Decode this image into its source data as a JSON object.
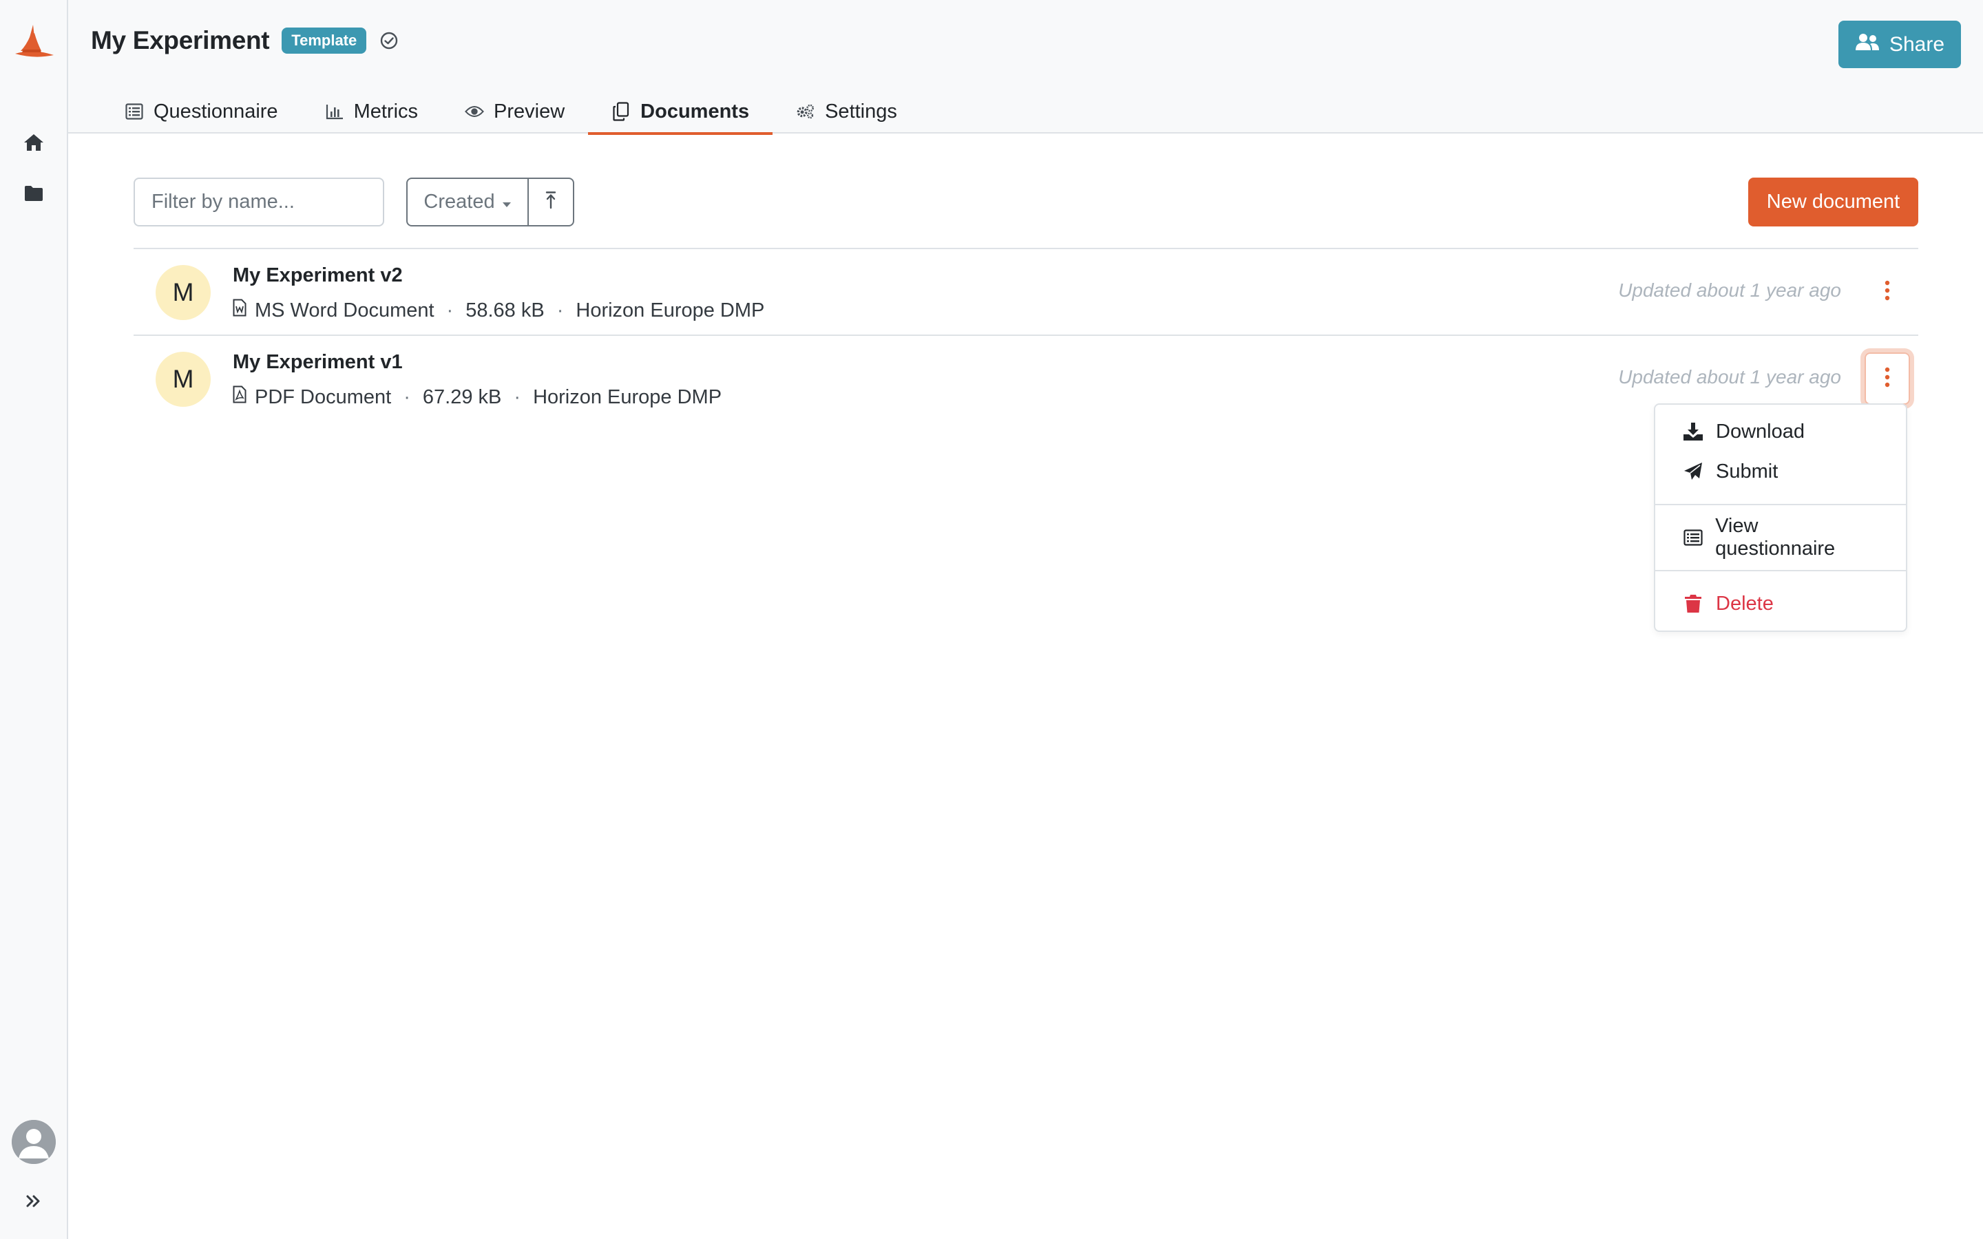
{
  "sidebar": {
    "logo": "wizard-hat-logo",
    "items": [
      {
        "icon": "home-icon",
        "label": ""
      },
      {
        "icon": "folder-icon",
        "label": ""
      }
    ],
    "profile_icon": "user-avatar-icon",
    "expand_icon": "double-chevron-right-icon"
  },
  "header": {
    "title": "My Experiment",
    "badge": "Template",
    "status_icon": "check-circle-icon",
    "share_label": "Share"
  },
  "tabs": [
    {
      "label": "Questionnaire",
      "icon": "list-icon",
      "active": false
    },
    {
      "label": "Metrics",
      "icon": "bar-chart-icon",
      "active": false
    },
    {
      "label": "Preview",
      "icon": "eye-icon",
      "active": false
    },
    {
      "label": "Documents",
      "icon": "copy-icon",
      "active": true
    },
    {
      "label": "Settings",
      "icon": "gears-icon",
      "active": false
    }
  ],
  "toolbar": {
    "filter_placeholder": "Filter by name...",
    "sort_label": "Created",
    "sort_direction_icon": "arrow-up-icon",
    "new_document_label": "New document"
  },
  "documents": [
    {
      "initial": "M",
      "name": "My Experiment v2",
      "type": "MS Word Document",
      "type_icon": "file-word-icon",
      "size": "58.68 kB",
      "template": "Horizon Europe DMP",
      "updated": "Updated about 1 year ago"
    },
    {
      "initial": "M",
      "name": "My Experiment v1",
      "type": "PDF Document",
      "type_icon": "file-pdf-icon",
      "size": "67.29 kB",
      "template": "Horizon Europe DMP",
      "updated": "Updated about 1 year ago"
    }
  ],
  "dropdown": {
    "download": "Download",
    "submit": "Submit",
    "view_questionnaire": "View questionnaire",
    "delete": "Delete"
  },
  "colors": {
    "accent": "#e05d2e",
    "info": "#3c98b1",
    "danger": "#dc3545",
    "avatar_bg": "#fcefc0"
  },
  "separator": "·"
}
